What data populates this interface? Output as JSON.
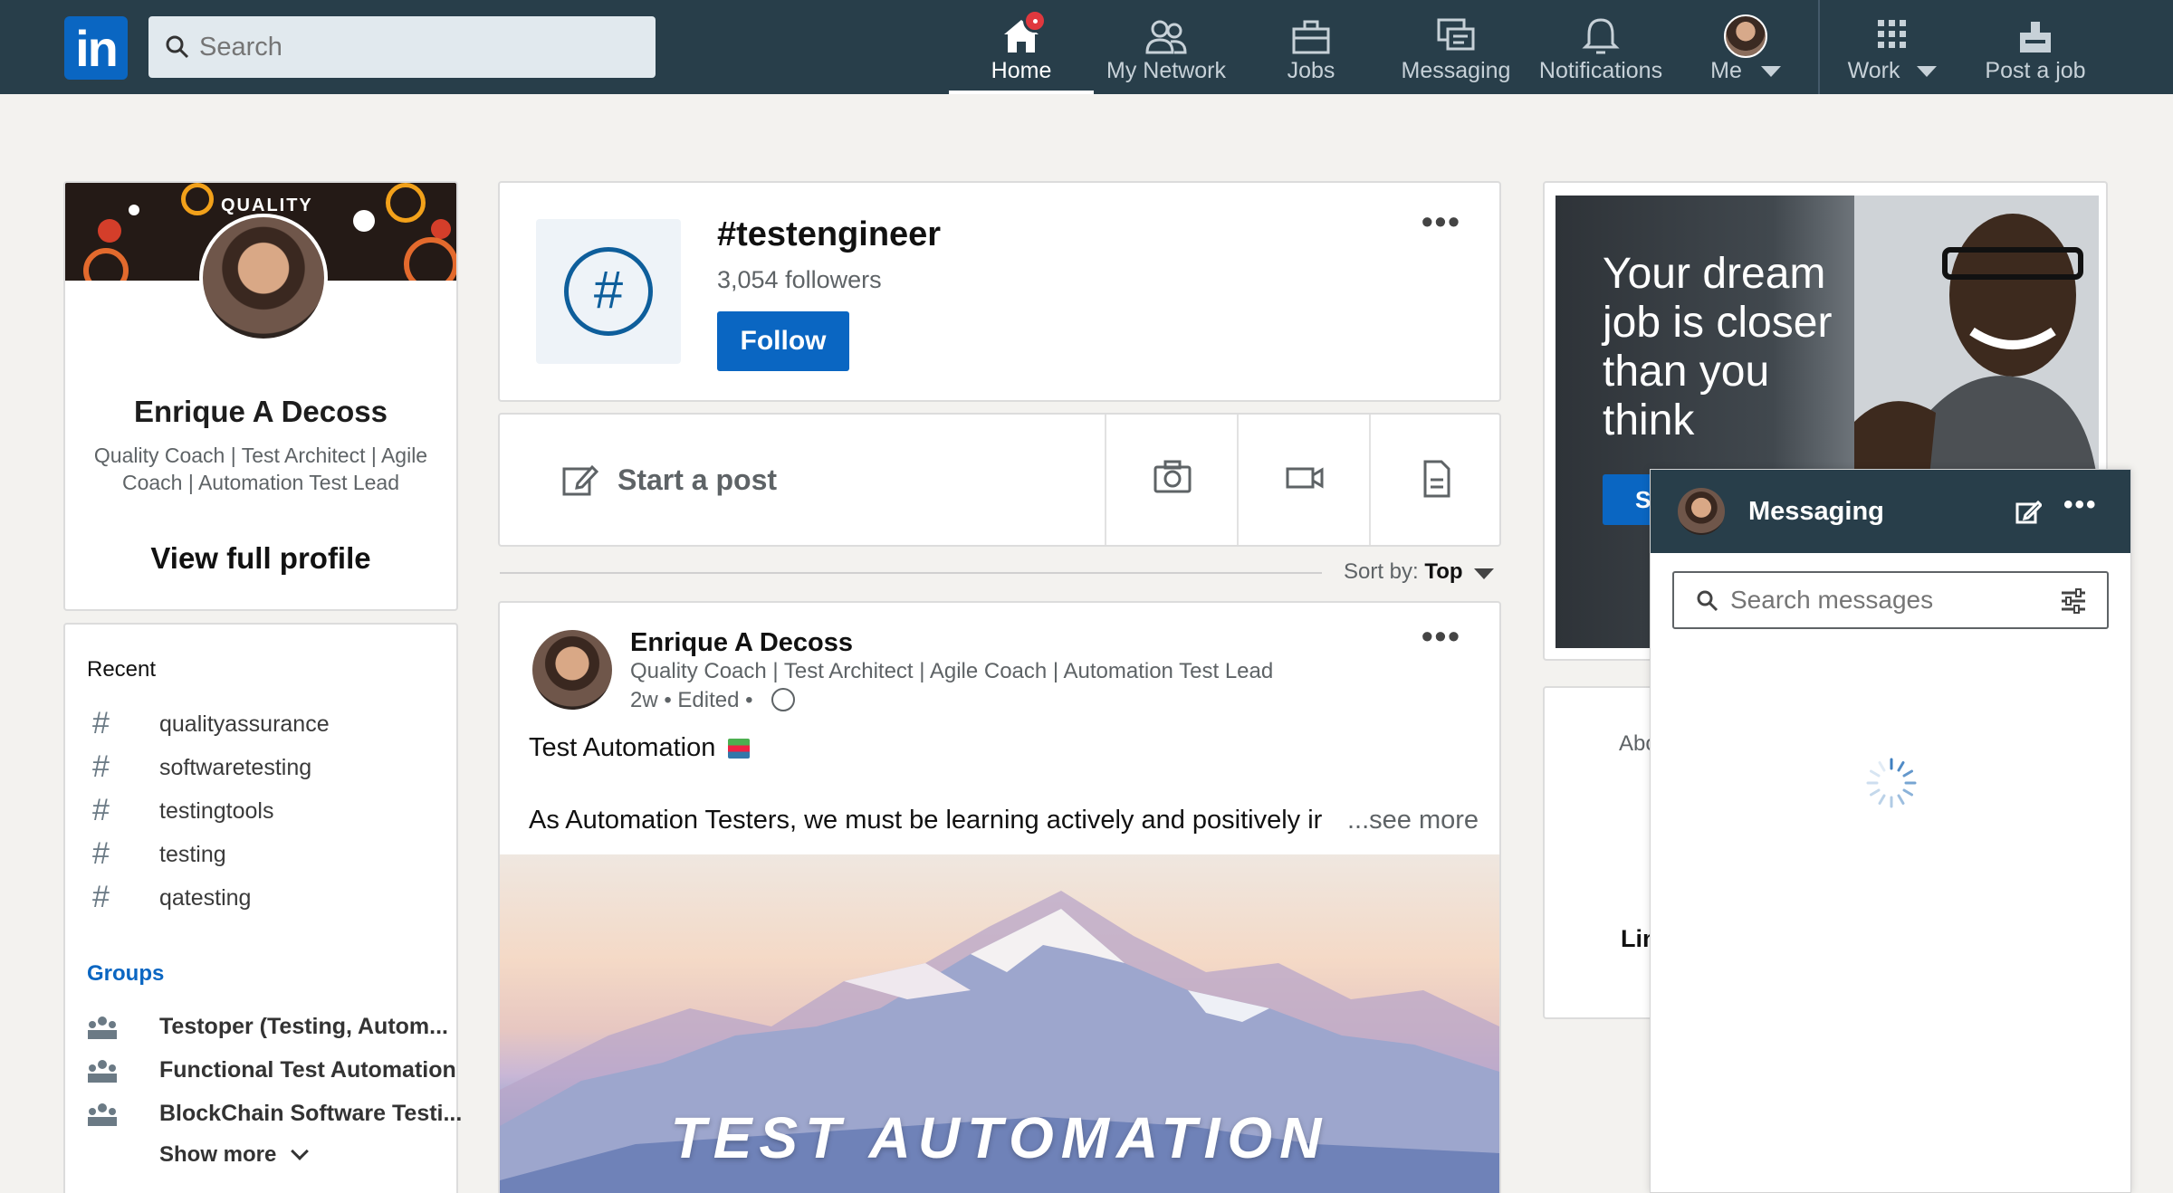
{
  "nav": {
    "logo": "in",
    "search_placeholder": "Search",
    "items": [
      {
        "label": "Home",
        "icon": "home-icon"
      },
      {
        "label": "My Network",
        "icon": "my-network-icon"
      },
      {
        "label": "Jobs",
        "icon": "jobs-icon"
      },
      {
        "label": "Messaging",
        "icon": "messaging-icon"
      },
      {
        "label": "Notifications",
        "icon": "bell-icon"
      },
      {
        "label": "Me",
        "icon": "avatar"
      },
      {
        "label": "Work",
        "icon": "grid-icon"
      },
      {
        "label": "Post a job",
        "icon": "post-job-icon"
      }
    ],
    "active": "Home",
    "accent": "#283e4a"
  },
  "profile": {
    "cover_text": "QUALITY",
    "name": "Enrique A Decoss",
    "headline": "Quality Coach | Test Architect | Agile Coach | Automation Test Lead",
    "view_profile": "View full profile"
  },
  "sidebar": {
    "recent_title": "Recent",
    "recent": [
      "qualityassurance",
      "softwaretesting",
      "testingtools",
      "testing",
      "qatesting"
    ],
    "groups_title": "Groups",
    "groups": [
      "Testoper (Testing, Autom...",
      "Functional Test Automation",
      "BlockChain Software Testi..."
    ],
    "show_more": "Show more"
  },
  "hashtag": {
    "symbol": "#",
    "name": "#testengineer",
    "followers": "3,054 followers",
    "follow_label": "Follow",
    "more": "•••"
  },
  "composer": {
    "start_post": "Start a post"
  },
  "sort": {
    "label": "Sort by:",
    "value": "Top"
  },
  "post": {
    "author": "Enrique A Decoss",
    "headline": "Quality Coach | Test Architect | Agile Coach | Automation Test Lead",
    "meta": "2w • Edited •",
    "title": "Test Automation",
    "body": "As Automation Testers, we must be learning actively and positively ir",
    "see_more": "...see more",
    "image_text": "TEST AUTOMATION",
    "more": "•••"
  },
  "ad": {
    "text": "Your dream job is closer than you think",
    "button": "S"
  },
  "about": {
    "about_fragment": "Abo",
    "lin_fragment": "Lin"
  },
  "messaging": {
    "title": "Messaging",
    "search_placeholder": "Search messages",
    "more": "•••"
  },
  "colors": {
    "brand": "#0a66c2",
    "badge": "#e0383e"
  }
}
